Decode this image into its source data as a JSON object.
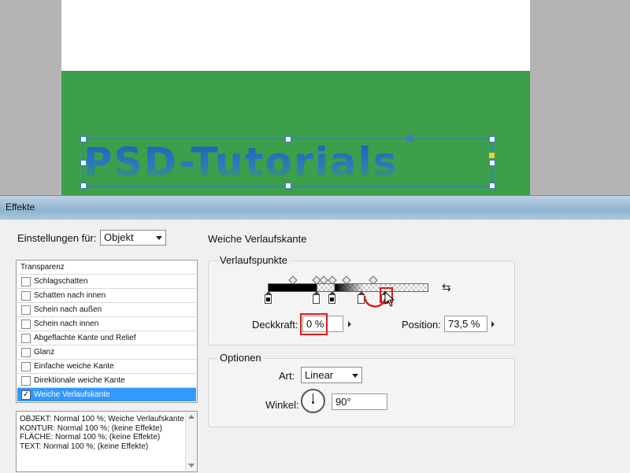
{
  "canvas": {
    "text": "PSD-Tutorials",
    "colors": {
      "page": "#ffffff",
      "band": "#3d9e4c",
      "frame": "#3a78c8",
      "text": "#1e63b5"
    }
  },
  "dialog": {
    "title": "Effekte",
    "settings_label": "Einstellungen für:",
    "settings_value": "Objekt",
    "effects_header": "Transparenz",
    "effects": [
      {
        "label": "Schlagschatten",
        "checked": false
      },
      {
        "label": "Schatten nach innen",
        "checked": false
      },
      {
        "label": "Schein nach außen",
        "checked": false
      },
      {
        "label": "Schein nach innen",
        "checked": false
      },
      {
        "label": "Abgeflachte Kante und Relief",
        "checked": false
      },
      {
        "label": "Glanz",
        "checked": false
      },
      {
        "label": "Einfache weiche Kante",
        "checked": false
      },
      {
        "label": "Direktionale weiche Kante",
        "checked": false
      },
      {
        "label": "Weiche Verlaufskante",
        "checked": true
      }
    ],
    "summary": [
      "OBJEKT: Normal 100 %; Weiche Verlaufskante",
      "KONTUR: Normal 100 %; (keine Effekte)",
      "FLÄCHE: Normal 100 %; (keine Effekte)",
      "TEXT: Normal 100 %; (keine Effekte)"
    ],
    "section_title": "Weiche Verlaufskante",
    "gradient_group_title": "Verlaufspunkte",
    "opacity_label": "Deckkraft:",
    "opacity_value": "0 %",
    "position_label": "Position:",
    "position_value": "73,5 %",
    "options_group_title": "Optionen",
    "type_label": "Art:",
    "type_value": "Linear",
    "angle_label": "Winkel:",
    "angle_value": "90°",
    "highlight_color": "#d81e1e",
    "selection_color": "#3399ff"
  }
}
